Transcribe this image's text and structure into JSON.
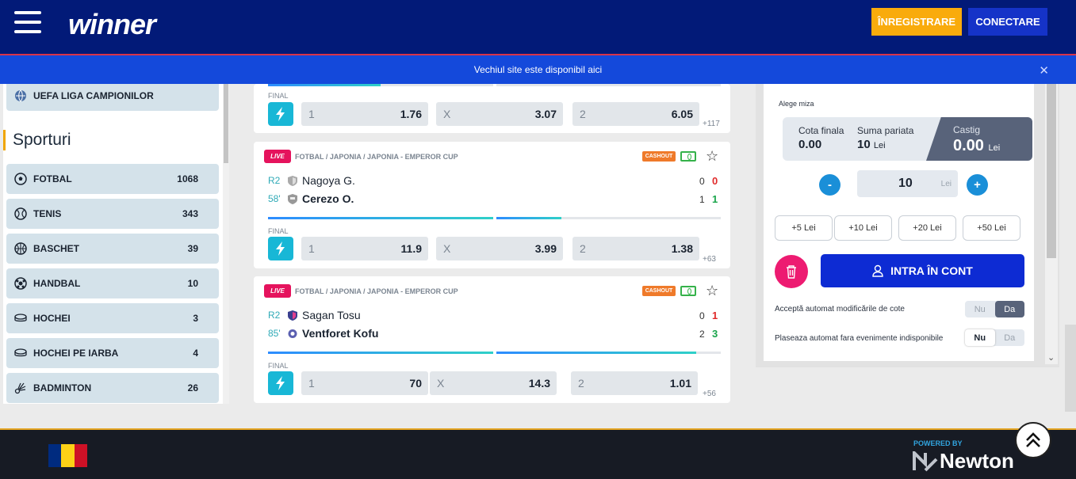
{
  "header": {
    "logo": "winner",
    "register_label": "ÎNREGISTRARE",
    "login_label": "CONECTARE"
  },
  "banner": {
    "text": "Vechiul site este disponibil aici",
    "close": "✕"
  },
  "sidebar": {
    "top_item": "UEFA LIGA CAMPIONILOR",
    "heading": "Sporturi",
    "sports": [
      {
        "label": "FOTBAL",
        "count": "1068",
        "icon": "soccer-ball-icon"
      },
      {
        "label": "TENIS",
        "count": "343",
        "icon": "tennis-ball-icon"
      },
      {
        "label": "BASCHET",
        "count": "39",
        "icon": "basketball-icon"
      },
      {
        "label": "HANDBAL",
        "count": "10",
        "icon": "handball-icon"
      },
      {
        "label": "HOCHEI",
        "count": "3",
        "icon": "hockey-puck-icon"
      },
      {
        "label": "HOCHEI PE IARBA",
        "count": "4",
        "icon": "field-hockey-icon"
      },
      {
        "label": "BADMINTON",
        "count": "26",
        "icon": "shuttlecock-icon"
      }
    ]
  },
  "events": [
    {
      "final_label": "FINAL",
      "odds": [
        {
          "k": "1",
          "v": "1.76"
        },
        {
          "k": "X",
          "v": "3.07"
        },
        {
          "k": "2",
          "v": "6.05"
        }
      ],
      "more": "+117",
      "progress": [
        0.5,
        0.0
      ]
    },
    {
      "live": "LIVE",
      "league": "FOTBAL / JAPONIA / JAPONIA - EMPEROR CUP",
      "cashout": "CASHOUT",
      "period": "R2",
      "minute": "58'",
      "home": "Nagoya G.",
      "away": "Cerezo O.",
      "home_scores": [
        "0",
        "0"
      ],
      "away_scores": [
        "1",
        "1"
      ],
      "final_label": "FINAL",
      "odds": [
        {
          "k": "1",
          "v": "11.9"
        },
        {
          "k": "X",
          "v": "3.99"
        },
        {
          "k": "2",
          "v": "1.38"
        }
      ],
      "more": "+63",
      "progress": [
        1.0,
        0.29
      ]
    },
    {
      "live": "LIVE",
      "league": "FOTBAL / JAPONIA / JAPONIA - EMPEROR CUP",
      "cashout": "CASHOUT",
      "period": "R2",
      "minute": "85'",
      "home": "Sagan Tosu",
      "away": "Ventforet Kofu",
      "home_scores": [
        "0",
        "1"
      ],
      "away_scores": [
        "2",
        "3"
      ],
      "final_label": "FINAL",
      "odds": [
        {
          "k": "1",
          "v": "70"
        },
        {
          "k": "X",
          "v": "14.3"
        },
        {
          "k": "2",
          "v": "1.01"
        }
      ],
      "more": "+56",
      "progress": [
        1.0,
        0.89
      ]
    }
  ],
  "betslip": {
    "stake_label": "Alege miza",
    "final_odds_label": "Cota finala",
    "final_odds_value": "0.00",
    "stake_sum_label": "Suma pariata",
    "stake_sum_value": "10",
    "currency": "Lei",
    "win_label": "Castig",
    "win_value": "0.00",
    "minus": "-",
    "plus": "+",
    "amount": "10",
    "quick_amounts": [
      "+5 Lei",
      "+10 Lei",
      "+20 Lei",
      "+50 Lei"
    ],
    "login_label": "INTRA ÎN CONT",
    "auto_accept_label": "Acceptă automat modificările de cote",
    "auto_place_label": "Plaseaza automat fara evenimente indisponibile",
    "no": "Nu",
    "yes": "Da"
  },
  "footer": {
    "powered_by": "POWERED BY",
    "brand": "Newton",
    "flag_colors": [
      "#002b7f",
      "#fcd116",
      "#ce1126"
    ]
  }
}
